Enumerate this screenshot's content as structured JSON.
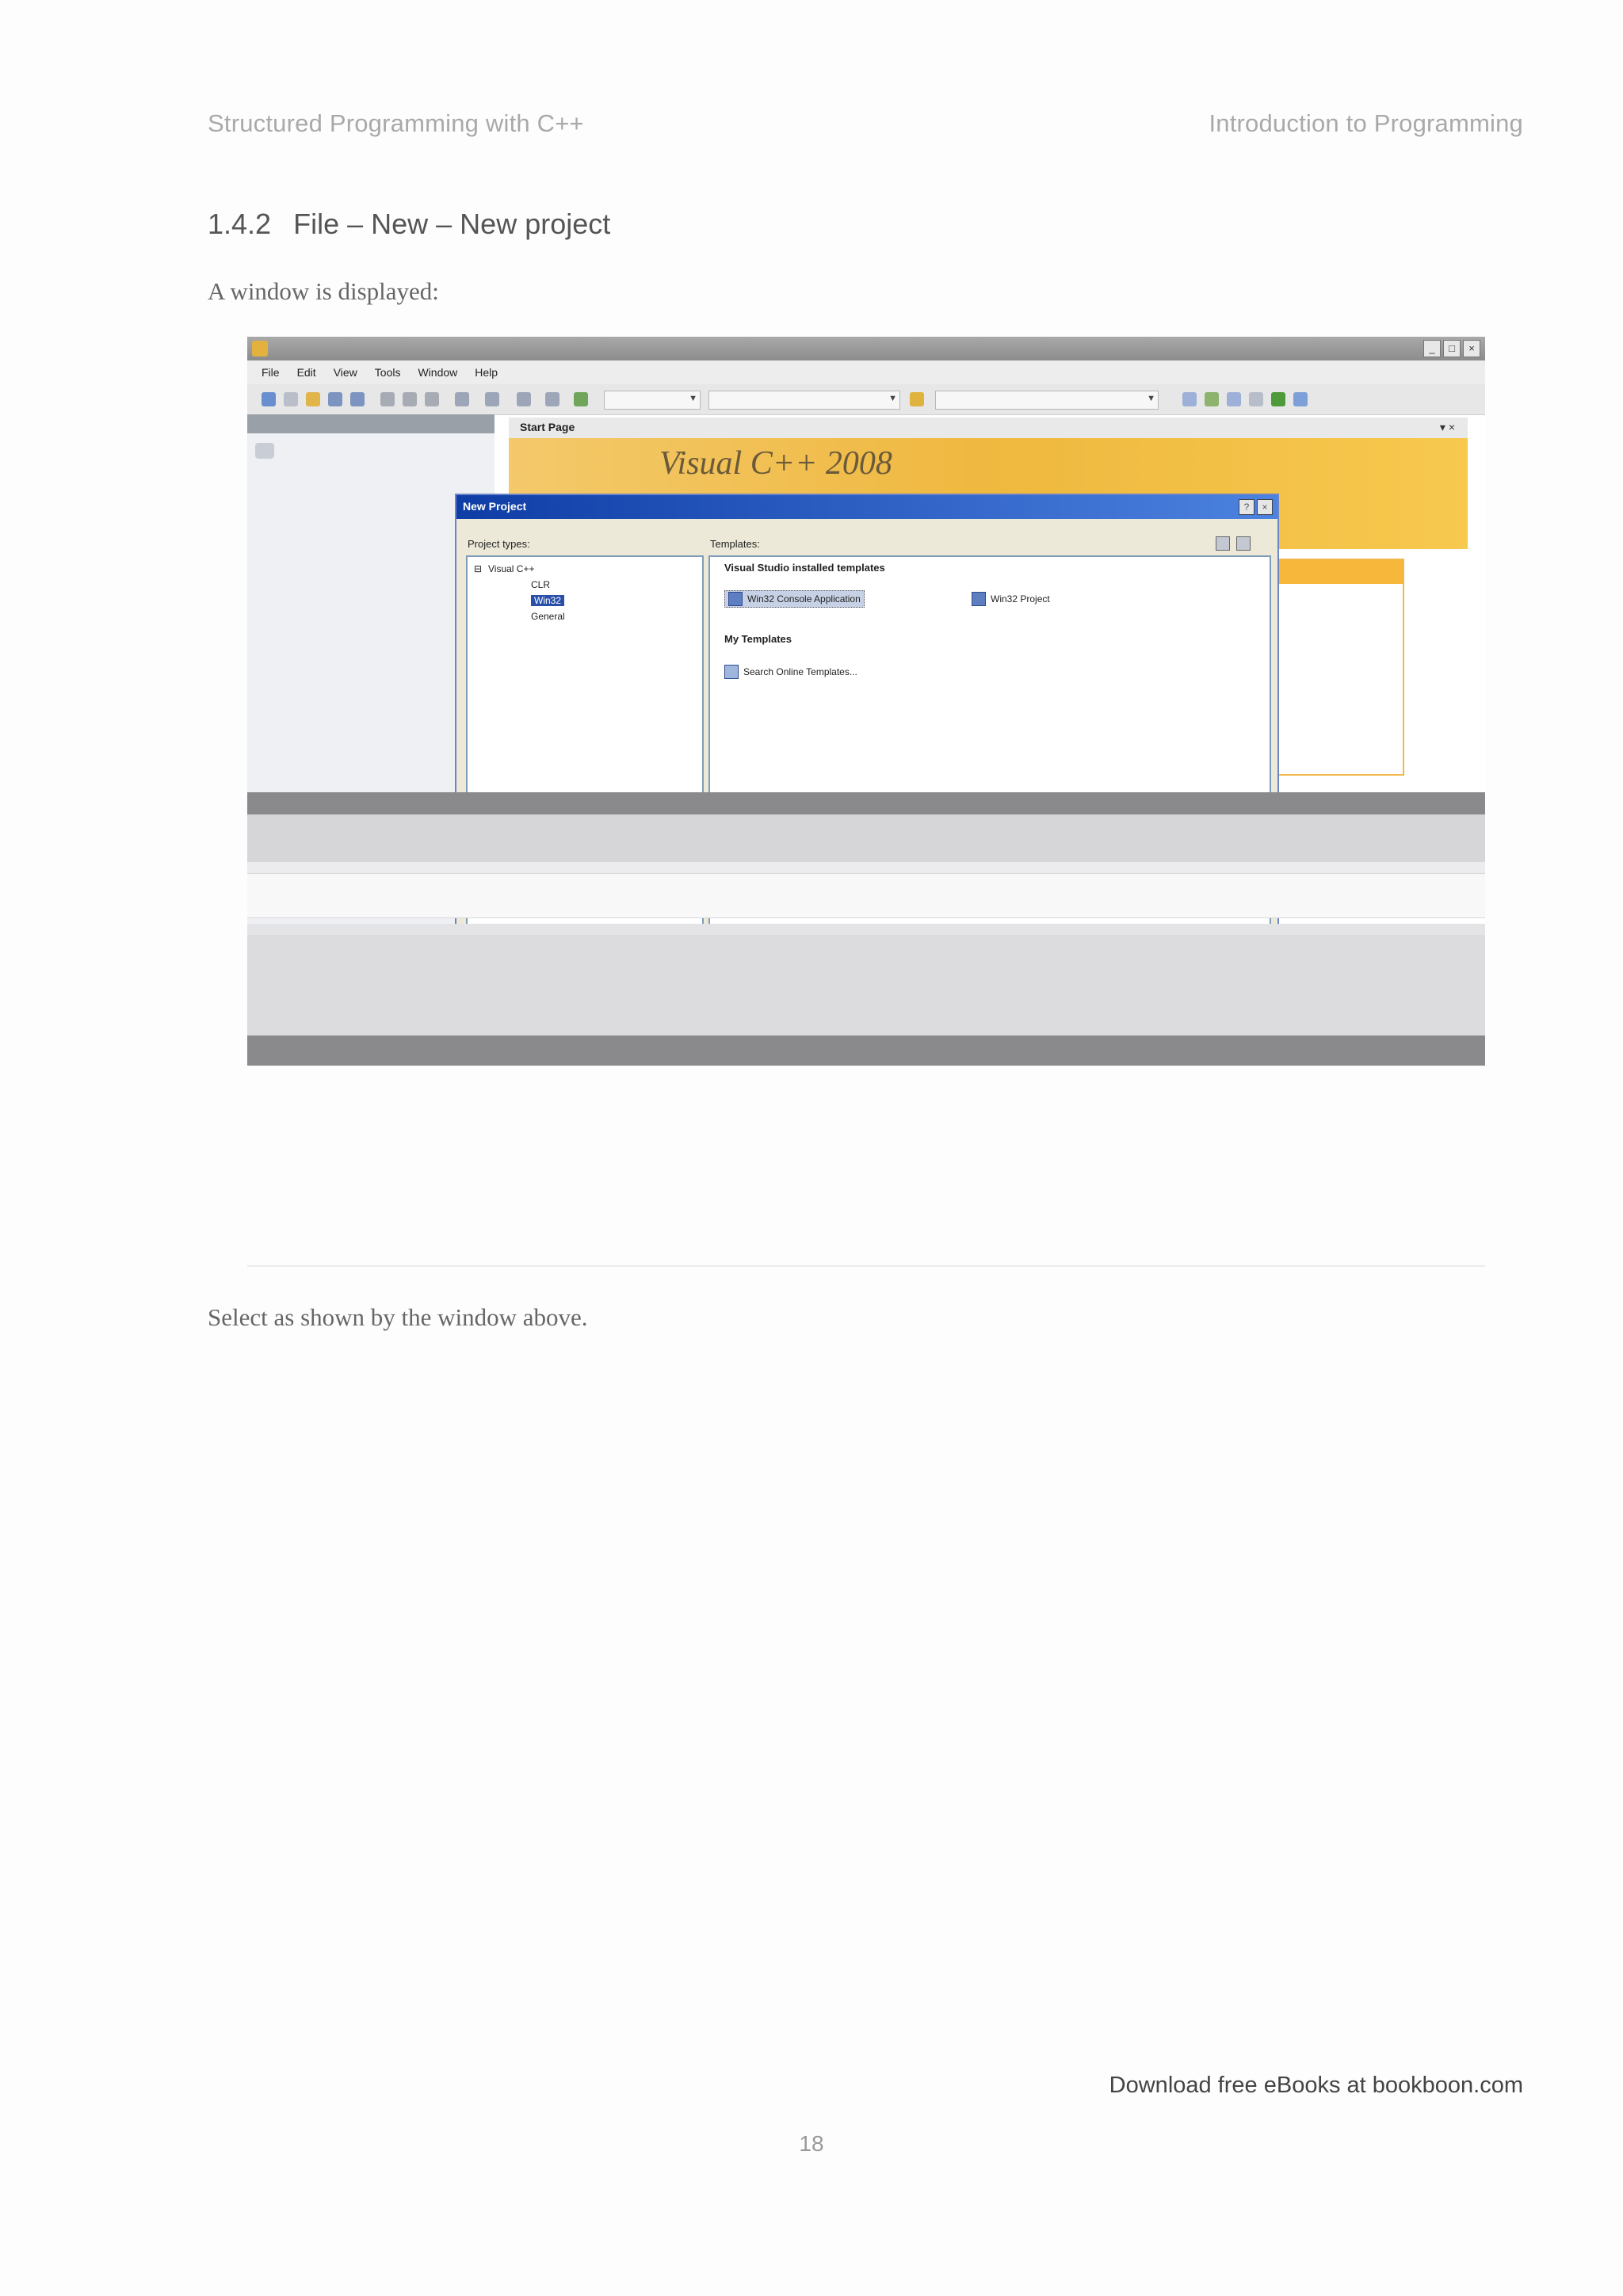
{
  "header": {
    "left": "Structured Programming with C++",
    "right": "Introduction to Programming"
  },
  "section": {
    "number": "1.4.2",
    "title": "File – New – New project"
  },
  "body": {
    "intro": "A window is displayed:",
    "after_figure": "Select as shown by the window above."
  },
  "figure": {
    "ide": {
      "menu": [
        "File",
        "Edit",
        "View",
        "Tools",
        "Window",
        "Help"
      ],
      "start_page_tab": "Start Page",
      "banner_logo": "Visual C++ 2008",
      "window_buttons": [
        "_",
        "□",
        "×"
      ]
    },
    "dialog": {
      "title": "New Project",
      "title_buttons": [
        "?",
        "×"
      ],
      "project_types_label": "Project types:",
      "templates_label": "Templates:",
      "tree": [
        "Visual C++",
        "CLR",
        "Win32",
        "General"
      ],
      "tree_expander": "⊟",
      "tree_selected_index": 2,
      "installed_heading": "Visual Studio installed templates",
      "installed_templates": [
        "Win32 Console Application",
        "Win32 Project"
      ],
      "my_templates_heading": "My Templates",
      "my_templates": [
        "Search Online Templates..."
      ]
    }
  },
  "footer": {
    "link": "Download free eBooks at bookboon.com",
    "page_number": "18"
  },
  "colors": {
    "running_head": "#a9a9a9",
    "banner_orange": "#efb83f",
    "dialog_title_blue": "#0f3da6"
  }
}
